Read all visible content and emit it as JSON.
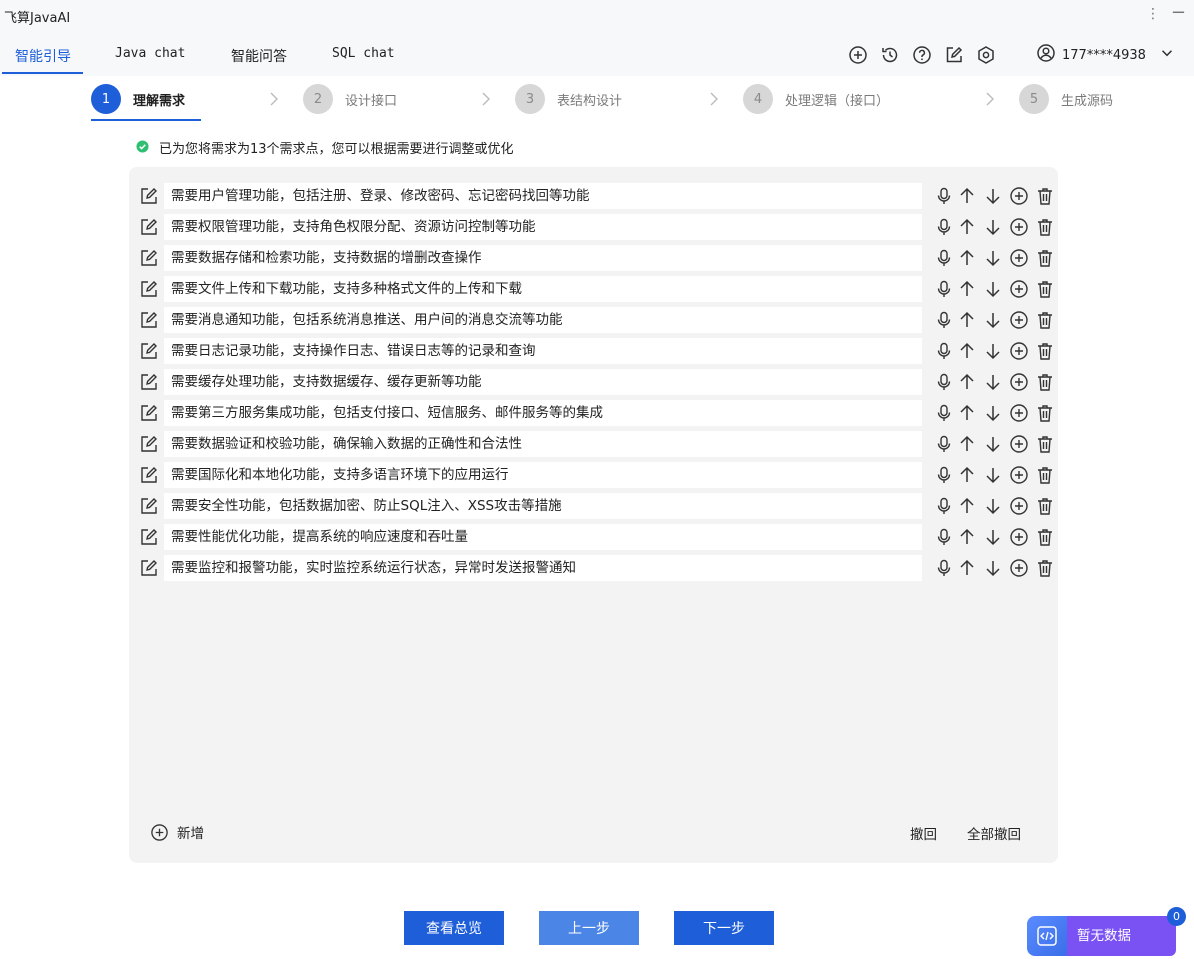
{
  "window": {
    "title": "飞算JavaAI",
    "more_glyph": "⋮",
    "minimize_glyph": "−"
  },
  "nav": {
    "tabs": [
      {
        "label": "智能引导",
        "active": true
      },
      {
        "label": "Java chat",
        "active": false
      },
      {
        "label": "智能问答",
        "active": false
      },
      {
        "label": "SQL chat",
        "active": false
      }
    ],
    "icons": [
      "add-circle-icon",
      "history-icon",
      "help-icon",
      "edit-icon",
      "settings-icon"
    ],
    "user": {
      "name": "177****4938",
      "icon": "user-icon",
      "dropdown_icon": "chevron-down-icon"
    }
  },
  "steps": [
    {
      "num": "1",
      "label": "理解需求",
      "active": true
    },
    {
      "num": "2",
      "label": "设计接口",
      "active": false
    },
    {
      "num": "3",
      "label": "表结构设计",
      "active": false
    },
    {
      "num": "4",
      "label": "处理逻辑（接口）",
      "active": false
    },
    {
      "num": "5",
      "label": "生成源码",
      "active": false
    }
  ],
  "notice": {
    "text": "已为您将需求为13个需求点，您可以根据需要进行调整或优化",
    "icon": "success-check-icon",
    "color": "#2fbf71"
  },
  "requirements": [
    "需要用户管理功能，包括注册、登录、修改密码、忘记密码找回等功能",
    "需要权限管理功能，支持角色权限分配、资源访问控制等功能",
    "需要数据存储和检索功能，支持数据的增删改查操作",
    "需要文件上传和下载功能，支持多种格式文件的上传和下载",
    "需要消息通知功能，包括系统消息推送、用户间的消息交流等功能",
    "需要日志记录功能，支持操作日志、错误日志等的记录和查询",
    "需要缓存处理功能，支持数据缓存、缓存更新等功能",
    "需要第三方服务集成功能，包括支付接口、短信服务、邮件服务等的集成",
    "需要数据验证和校验功能，确保输入数据的正确性和合法性",
    "需要国际化和本地化功能，支持多语言环境下的应用运行",
    "需要安全性功能，包括数据加密、防止SQL注入、XSS攻击等措施",
    "需要性能优化功能，提高系统的响应速度和吞吐量",
    "需要监控和报警功能，实时监控系统运行状态，异常时发送报警通知"
  ],
  "row_actions": [
    "mic-icon",
    "arrow-up-icon",
    "arrow-down-icon",
    "add-circle-icon",
    "trash-icon"
  ],
  "panel_footer": {
    "add_label": "新增",
    "undo_label": "撤回",
    "undo_all_label": "全部撤回"
  },
  "buttons": {
    "overview": "查看总览",
    "prev": "上一步",
    "next": "下一步"
  },
  "floater": {
    "label": "暂无数据",
    "badge": "0",
    "icon": "code-icon"
  },
  "colors": {
    "accent": "#1e5ed8",
    "accent_light": "#4b86e6",
    "purple": "#7a52f4",
    "panel_bg": "#f3f3f3"
  }
}
